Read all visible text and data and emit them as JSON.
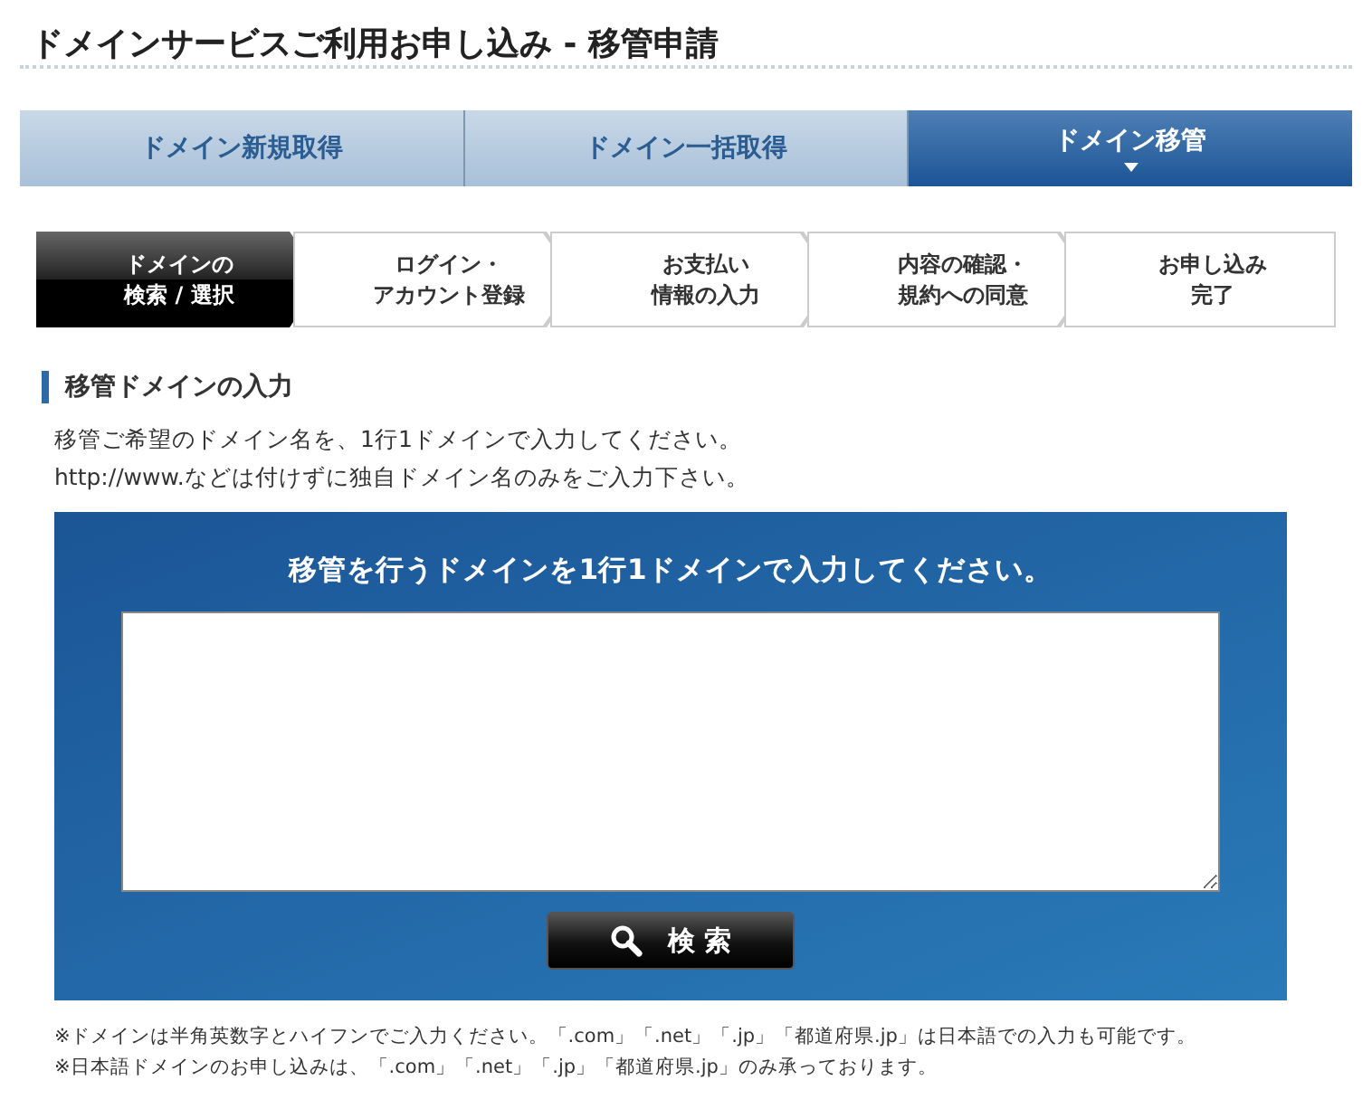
{
  "page_title": "ドメインサービスご利用お申し込み - 移管申請",
  "tabs": [
    {
      "label": "ドメイン新規取得",
      "selected": false
    },
    {
      "label": "ドメイン一括取得",
      "selected": false
    },
    {
      "label": "ドメイン移管",
      "selected": true
    }
  ],
  "steps": [
    {
      "lines": [
        "ドメインの",
        "検索 / 選択"
      ],
      "selected": true
    },
    {
      "lines": [
        "ログイン・",
        "アカウント登録"
      ],
      "selected": false
    },
    {
      "lines": [
        "お支払い",
        "情報の入力"
      ],
      "selected": false
    },
    {
      "lines": [
        "内容の確認・",
        "規約への同意"
      ],
      "selected": false
    },
    {
      "lines": [
        "お申し込み",
        "完了"
      ],
      "selected": false
    }
  ],
  "section_heading": "移管ドメインの入力",
  "intro": [
    "移管ご希望のドメイン名を、1行1ドメインで入力してください。",
    "http://www.などは付けずに独自ドメイン名のみをご入力下さい。"
  ],
  "form": {
    "heading": "移管を行うドメインを1行1ドメインで入力してください。",
    "search_button": "検 索"
  },
  "notes": [
    "※ドメインは半角英数字とハイフンでご入力ください。「.com」「.net」「.jp」「都道府県.jp」は日本語での入力も可能です。",
    "※日本語ドメインのお申し込みは、「.com」「.net」「.jp」「都道府県.jp」のみ承っております。"
  ]
}
